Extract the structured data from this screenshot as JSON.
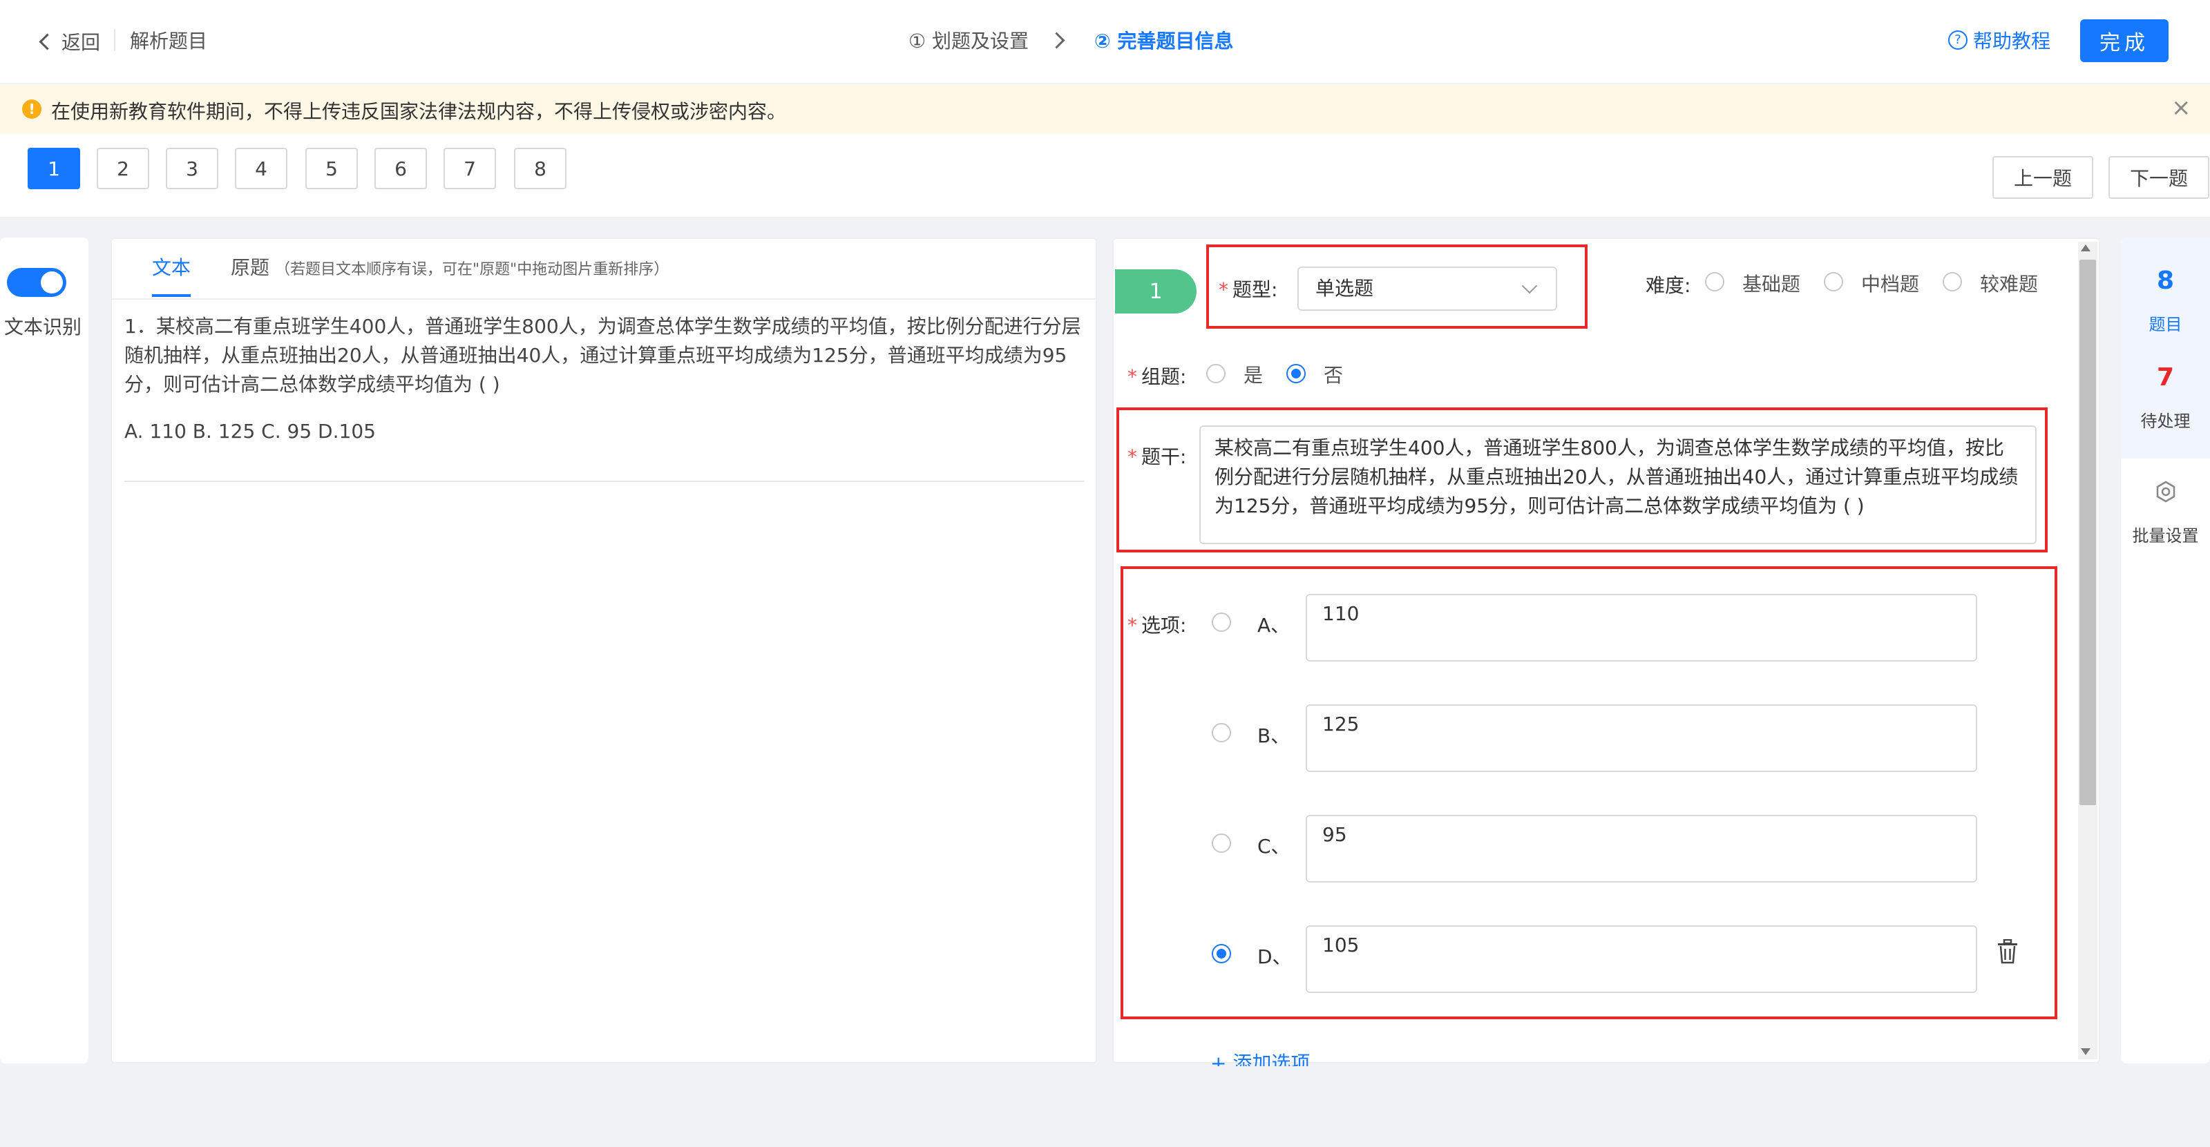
{
  "header": {
    "back_label": "返回",
    "page_title": "解析题目",
    "step1": "① 划题及设置",
    "step2": "② 完善题目信息",
    "help_label": "帮助教程",
    "help_icon": "question-circle-icon",
    "done_label": "完成"
  },
  "notice": {
    "text": "在使用新教育软件期间，不得上传违反国家法律法规内容，不得上传侵权或涉密内容。",
    "close_glyph": "×"
  },
  "pager": {
    "pages": [
      "1",
      "2",
      "3",
      "4",
      "5",
      "6",
      "7",
      "8"
    ],
    "active": "1",
    "prev_label": "上一题",
    "next_label": "下一题"
  },
  "ocr": {
    "label": "文本识别",
    "enabled": true
  },
  "source": {
    "tab_text": "文本",
    "tab_original": "原题",
    "tab_note": "（若题目文本顺序有误，可在\"原题\"中拖动图片重新排序）",
    "question_text": "1．某校高二有重点班学生400人，普通班学生800人，为调查总体学生数学成绩的平均值，按比例分配进行分层随机抽样，从重点班抽出20人，从普通班抽出40人，通过计算重点班平均成绩为125分，普通班平均成绩为95分，则可估计高二总体数学成绩平均值为 ( )",
    "options_line": "A. 110 B. 125 C. 95 D.105"
  },
  "editor": {
    "question_number": "1",
    "type_label": "题型:",
    "type_value": "单选题",
    "difficulty_label": "难度:",
    "difficulty_options": [
      "基础题",
      "中档题",
      "较难题"
    ],
    "group_label": "组题:",
    "group_yes": "是",
    "group_no": "否",
    "group_selected": "否",
    "stem_label": "题干:",
    "stem_text": "某校高二有重点班学生400人，普通班学生800人，为调查总体学生数学成绩的平均值，按比例分配进行分层随机抽样，从重点班抽出20人，从普通班抽出40人，通过计算重点班平均成绩为125分，普通班平均成绩为95分，则可估计高二总体数学成绩平均值为 ( )",
    "options_label": "选项:",
    "options": [
      {
        "letter": "A、",
        "value": "110"
      },
      {
        "letter": "B、",
        "value": "125"
      },
      {
        "letter": "C、",
        "value": "95"
      },
      {
        "letter": "D、",
        "value": "105"
      }
    ],
    "correct_option": "D、",
    "add_option_label": "+ 添加选项"
  },
  "summary": {
    "total_count": "8",
    "total_label": "题目",
    "pending_count": "7",
    "pending_label": "待处理",
    "batch_label": "批量设置",
    "batch_icon": "gear-icon",
    "total_color": "#1677ff",
    "pending_color": "#e8282b"
  },
  "colors": {
    "accent": "#1677ff",
    "highlight_box": "#e8282b",
    "question_badge": "#52c48c",
    "notice_bg": "#fff8e6"
  }
}
